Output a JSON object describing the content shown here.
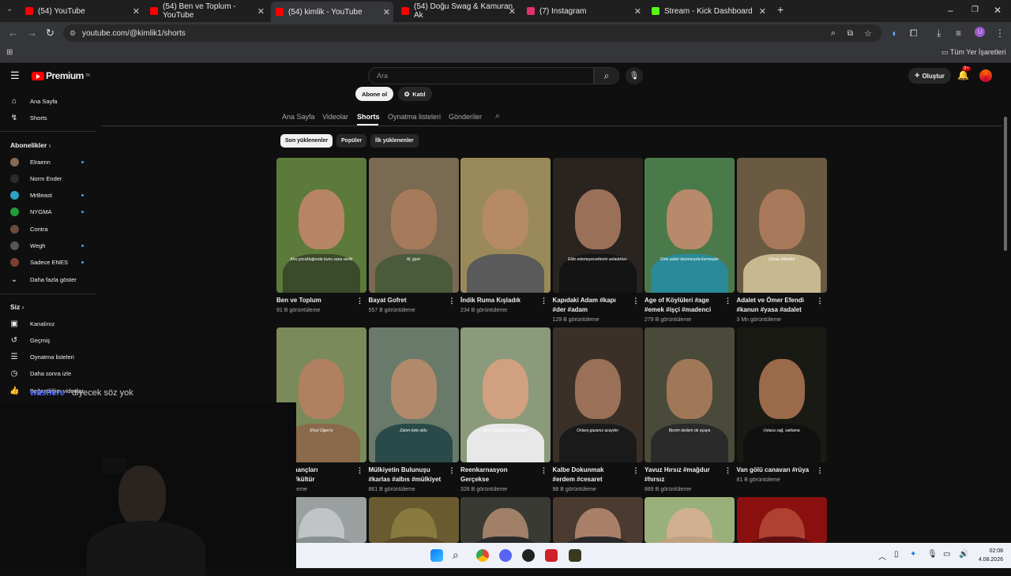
{
  "tabs": [
    {
      "label": "(54) YouTube",
      "color": "#ff0000"
    },
    {
      "label": "(54) Ben ve Toplum - YouTube",
      "color": "#ff0000"
    },
    {
      "label": "(54) kimlik - YouTube",
      "color": "#ff0000"
    },
    {
      "label": "(54) Doğu Swag & Kamuran Ak",
      "color": "#ff0000"
    },
    {
      "label": "(7) Instagram",
      "color": "#e1306c"
    },
    {
      "label": "Stream - Kick Dashboard",
      "color": "#53fc18"
    }
  ],
  "address": {
    "url": "youtube.com/@kimlik1/shorts"
  },
  "bookmarks": {
    "all_label": "Tüm Yer İşaretleri"
  },
  "header": {
    "brand": "Premium",
    "region": "TR",
    "search_placeholder": "Ara",
    "create_label": "Oluştur",
    "notif_badge": "9+"
  },
  "sidebar": {
    "home": "Ana Sayfa",
    "shorts": "Shorts",
    "subs_heading": "Abonelikler",
    "subscriptions": [
      {
        "name": "Elraenn",
        "color": "#8a6a55",
        "dot": true
      },
      {
        "name": "Norm Ender",
        "color": "#2c2c2c",
        "dot": false
      },
      {
        "name": "MrBeast",
        "color": "#2aa3c4",
        "dot": true
      },
      {
        "name": "NYGMA",
        "color": "#1f9d3a",
        "dot": true
      },
      {
        "name": "Contra",
        "color": "#6b4b3a",
        "dot": false
      },
      {
        "name": "Wegh",
        "color": "#555555",
        "dot": true
      },
      {
        "name": "Sadece ENES",
        "color": "#7a4030",
        "dot": true
      }
    ],
    "show_more": "Daha fazla göster",
    "you_heading": "Siz",
    "you_items": [
      "Kanalınız",
      "Geçmiş",
      "Oynatma listeleri",
      "Daha sonra izle",
      "Beğendiğim videolar"
    ]
  },
  "channel": {
    "subscribe_label": "Abone ol",
    "join_label": "Katıl",
    "tabs": [
      "Ana Sayfa",
      "Videolar",
      "Shorts",
      "Oynatma listeleri",
      "Gönderiler"
    ],
    "active_tab": "Shorts",
    "chips": [
      "Son yüklenenler",
      "Popüler",
      "İlk yüklenenler"
    ]
  },
  "shorts": [
    {
      "title1": "Ben ve Toplum",
      "title2": "",
      "views": "91 B görüntüleme",
      "caption": "Ahu çocukluğunda bunu sana verilir",
      "bg": "#5c7a3a",
      "skin": "#b88466",
      "cloth": "#3b4a2a"
    },
    {
      "title1": "Bayat Gofret",
      "title2": "",
      "views": "557 B görüntüleme",
      "caption": "Al, giyin",
      "bg": "#7a6a52",
      "skin": "#a77a5c",
      "cloth": "#4a5a3a"
    },
    {
      "title1": "İndik Ruma Kışladık",
      "title2": "",
      "views": "234 B görüntüleme",
      "caption": "",
      "bg": "#9a8a5a",
      "skin": "#b58a64",
      "cloth": "#5a5a5a"
    },
    {
      "title1": "Kapıdaki Adam #kapı",
      "title2": "#der #adam",
      "views": "129 B görüntüleme",
      "caption": "Elde edemeyeceklerini anladıkları",
      "bg": "#2a2420",
      "skin": "#9a7058",
      "cloth": "#141414"
    },
    {
      "title1": "Age of Köylüleri #age",
      "title2": "#emek #işçi #madenci",
      "views": "279 B görüntüleme",
      "caption": "Gine asker besmasıyla kurmeşler",
      "bg": "#4a7a4a",
      "skin": "#b8896a",
      "cloth": "#2a8a9a"
    },
    {
      "title1": "Adalet ve Ömer Efendi",
      "title2": "#kanun #yasa #adalet",
      "views": "3 Mn görüntüleme",
      "caption": "Olmaz efendim",
      "bg": "#6a5a42",
      "skin": "#a8785a",
      "cloth": "#c8b890"
    },
    {
      "title1": "Türk İnançları",
      "title2": "#töre #kültür",
      "views": "görüntüleme",
      "caption": "Efsul Ülgen'e",
      "bg": "#7a8a5a",
      "skin": "#b08060",
      "cloth": "#8a6a4a"
    },
    {
      "title1": "Mülkiyetin Bulunuşu",
      "title2": "#karlas #albıs #mülkiyet",
      "views": "861 B görüntüleme",
      "caption": "Zatım-öyle oldu",
      "bg": "#6a7a6a",
      "skin": "#b08a6a",
      "cloth": "#2a4a4a"
    },
    {
      "title1": "Reenkarnasyon",
      "title2": "Gerçekse",
      "views": "328 B görüntüleme",
      "caption": "Ben mümkünlü olmayanlı",
      "bg": "#8a9a7a",
      "skin": "#d0a080",
      "cloth": "#e8e8e8"
    },
    {
      "title1": "Kalbe Dokunmak",
      "title2": "#erdem #cesaret",
      "views": "98 B görüntüleme",
      "caption": "Onlara gazanız acaydın",
      "bg": "#3a3028",
      "skin": "#9a7058",
      "cloth": "#1a1a1a"
    },
    {
      "title1": "Yavuz Hırsız #mağdur",
      "title2": "#hırsız",
      "views": "889 B görüntüleme",
      "caption": "Benim dedem de açaya",
      "bg": "#4a4a3a",
      "skin": "#a07858",
      "cloth": "#2a2a2a"
    },
    {
      "title1": "Van gölü canavarı #rüya",
      "title2": "",
      "views": "81 B görüntüleme",
      "caption": "Ustaca sağ, saklama",
      "bg": "#1a1a14",
      "skin": "#9a6a4a",
      "cloth": "#101010"
    },
    {
      "title1": "",
      "title2": "",
      "views": "",
      "caption": "",
      "bg": "#9aa0a0",
      "skin": "#c0c4c4",
      "cloth": "#8a9090"
    },
    {
      "title1": "",
      "title2": "",
      "views": "",
      "caption": "",
      "bg": "#6a5a30",
      "skin": "#8a7a40",
      "cloth": "#5a4a28"
    },
    {
      "title1": "",
      "title2": "",
      "views": "",
      "caption": "",
      "bg": "#3a3a34",
      "skin": "#a08068",
      "cloth": "#2a2a2a"
    },
    {
      "title1": "",
      "title2": "",
      "views": "",
      "caption": "",
      "bg": "#4a3a30",
      "skin": "#a8806a",
      "cloth": "#2a2a2a"
    },
    {
      "title1": "",
      "title2": "",
      "views": "",
      "caption": "",
      "bg": "#9ab07a",
      "skin": "#d0b090",
      "cloth": "#c0a080"
    },
    {
      "title1": "",
      "title2": "",
      "views": "",
      "caption": "",
      "bg": "#8a1010",
      "skin": "#b04030",
      "cloth": "#601010"
    }
  ],
  "overlay": {
    "chat_user": "washere",
    "chat_msg": "diyecek söz yok"
  },
  "taskbar": {
    "time": "02:08",
    "date": "4.08.2026"
  }
}
